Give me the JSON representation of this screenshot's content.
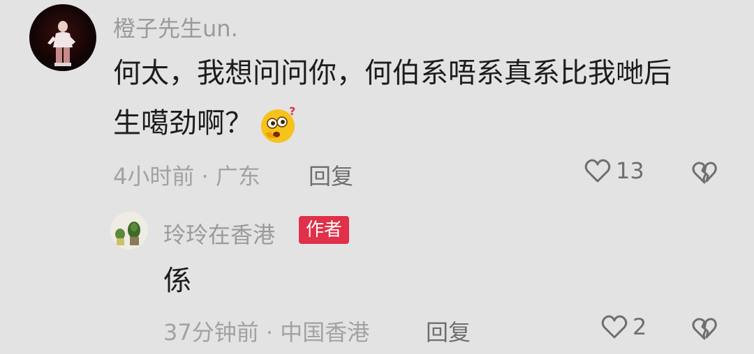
{
  "comment": {
    "username": "橙子先生un.",
    "text_line1": "何太，我想问问你，何伯系唔系真系比我哋后",
    "text_line2": "生噶劲啊？",
    "emoji": "thinking-face-emoji",
    "meta": "4小时前 · 广东",
    "reply_label": "回复",
    "like_count": "13"
  },
  "reply": {
    "username": "玲玲在香港",
    "author_badge": "作者",
    "text": "係",
    "meta": "37分钟前 · 中国香港",
    "reply_label": "回复",
    "like_count": "2"
  },
  "colors": {
    "background": "#e3e3e3",
    "author_badge": "#e0304a",
    "username": "#9a9a9a",
    "text": "#1c1c1c"
  }
}
